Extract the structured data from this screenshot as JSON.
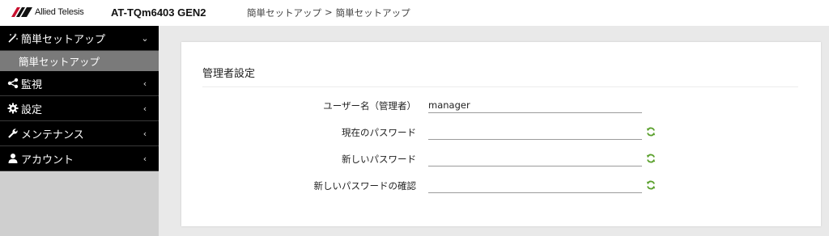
{
  "header": {
    "logo_text": "Allied Telesis",
    "model": "AT-TQm6403 GEN2",
    "breadcrumb": [
      "簡単セットアップ",
      ">",
      "簡単セットアップ"
    ]
  },
  "sidebar": {
    "items": [
      {
        "label": "簡単セットアップ",
        "icon": "magic-wand-icon",
        "chevron": "⌄",
        "expanded": true
      },
      {
        "label": "監視",
        "icon": "share-icon",
        "chevron": "‹"
      },
      {
        "label": "設定",
        "icon": "gear-icon",
        "chevron": "‹"
      },
      {
        "label": "メンテナンス",
        "icon": "wrench-icon",
        "chevron": "‹"
      },
      {
        "label": "アカウント",
        "icon": "user-icon",
        "chevron": "‹"
      }
    ],
    "subitem": "簡単セットアップ"
  },
  "panel": {
    "title": "管理者設定",
    "fields": [
      {
        "label": "ユーザー名（管理者）",
        "value": "manager",
        "refresh": false
      },
      {
        "label": "現在のパスワード",
        "value": "",
        "refresh": true
      },
      {
        "label": "新しいパスワード",
        "value": "",
        "refresh": true
      },
      {
        "label": "新しいパスワードの確認",
        "value": "",
        "refresh": true
      }
    ]
  },
  "colors": {
    "nav_bg": "#000000",
    "sub_bg": "#7a7a7a",
    "refresh_green": "#5aa02c"
  }
}
